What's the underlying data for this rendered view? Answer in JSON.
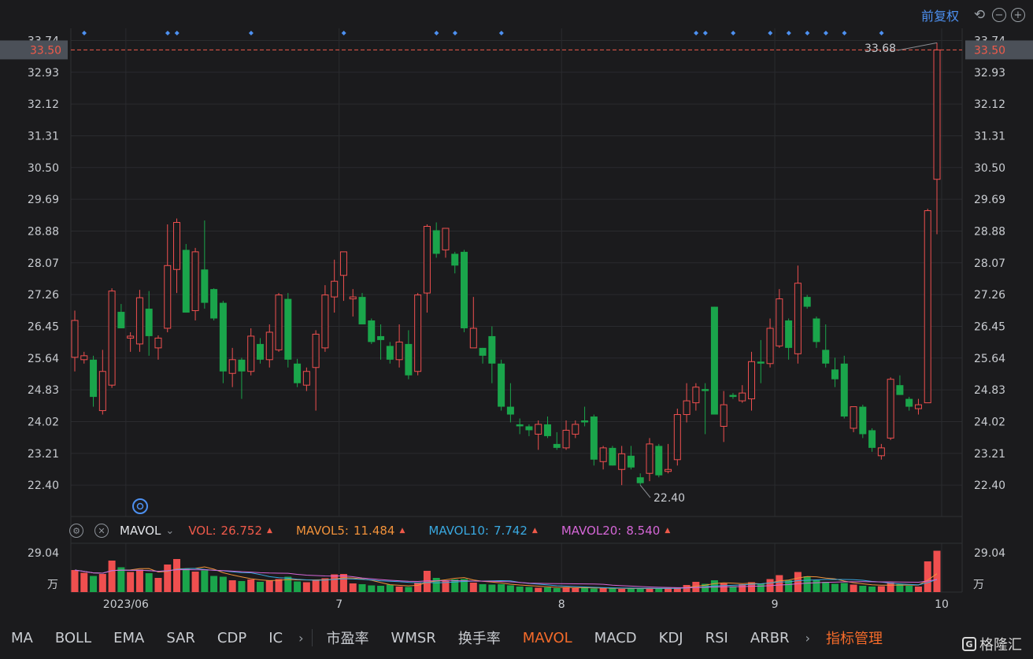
{
  "toolbar": {
    "adjust_label": "前复权",
    "undo_icon": "undo-icon",
    "zoom_out_icon": "minus-circle-icon",
    "zoom_in_icon": "plus-circle-icon"
  },
  "colors": {
    "up": "#ef4f4f",
    "down": "#1aa54b",
    "grid": "#2a2b2e",
    "price_tag": "#ef5a4a",
    "ma5": "#f0913a",
    "ma10": "#39a8e0",
    "ma20": "#d466d6"
  },
  "price_axis": {
    "ticks": [
      "33.74",
      "32.93",
      "32.12",
      "31.31",
      "30.50",
      "29.69",
      "28.88",
      "28.07",
      "27.26",
      "26.45",
      "25.64",
      "24.83",
      "24.02",
      "23.21",
      "22.40"
    ],
    "current_price": "33.50",
    "high_label": "33.68",
    "low_label": "22.40"
  },
  "volume_axis": {
    "top_label": "29.04",
    "unit_label": "万"
  },
  "date_axis": {
    "labels": [
      "2023/06",
      "7",
      "8",
      "9",
      "10"
    ]
  },
  "indicator": {
    "settings_icon": "gear-icon",
    "close_icon": "close-icon",
    "name": "MAVOL",
    "vol_label": "VOL:",
    "vol_value": "26.752",
    "mavol5_label": "MAVOL5:",
    "mavol5_value": "11.484",
    "mavol10_label": "MAVOL10:",
    "mavol10_value": "7.742",
    "mavol20_label": "MAVOL20:",
    "mavol20_value": "8.540"
  },
  "bottom_tabs": {
    "left": [
      "MA",
      "BOLL",
      "EMA",
      "SAR",
      "CDP",
      "IC"
    ],
    "right": [
      "市盈率",
      "WMSR",
      "换手率",
      "MAVOL",
      "MACD",
      "KDJ",
      "RSI",
      "ARBR"
    ],
    "active": "MAVOL",
    "manage": "指标管理",
    "logo_text": "格隆汇"
  },
  "chart_data": {
    "type": "candlestick",
    "ylim": [
      21.6,
      34.05
    ],
    "candles": [
      {
        "o": 25.66,
        "h": 26.85,
        "l": 25.3,
        "c": 26.6
      },
      {
        "o": 25.6,
        "h": 25.8,
        "l": 25.5,
        "c": 25.7
      },
      {
        "o": 25.6,
        "h": 25.7,
        "l": 24.4,
        "c": 24.65
      },
      {
        "o": 24.3,
        "h": 25.85,
        "l": 24.2,
        "c": 25.3
      },
      {
        "o": 24.95,
        "h": 27.42,
        "l": 24.88,
        "c": 27.35
      },
      {
        "o": 26.82,
        "h": 27.02,
        "l": 26.4,
        "c": 26.4
      },
      {
        "o": 26.15,
        "h": 26.3,
        "l": 25.8,
        "c": 26.2
      },
      {
        "o": 26.0,
        "h": 27.38,
        "l": 25.8,
        "c": 27.18
      },
      {
        "o": 26.9,
        "h": 27.35,
        "l": 25.7,
        "c": 26.2
      },
      {
        "o": 25.9,
        "h": 26.22,
        "l": 25.6,
        "c": 26.15
      },
      {
        "o": 26.4,
        "h": 29.05,
        "l": 26.3,
        "c": 28.0
      },
      {
        "o": 27.9,
        "h": 29.2,
        "l": 27.3,
        "c": 29.1
      },
      {
        "o": 28.4,
        "h": 28.55,
        "l": 26.8,
        "c": 26.8
      },
      {
        "o": 26.85,
        "h": 28.45,
        "l": 26.6,
        "c": 28.35
      },
      {
        "o": 27.9,
        "h": 29.15,
        "l": 26.9,
        "c": 27.05
      },
      {
        "o": 27.4,
        "h": 27.42,
        "l": 26.6,
        "c": 26.65
      },
      {
        "o": 27.05,
        "h": 27.1,
        "l": 25.0,
        "c": 25.3
      },
      {
        "o": 25.25,
        "h": 25.9,
        "l": 24.9,
        "c": 25.6
      },
      {
        "o": 25.6,
        "h": 25.65,
        "l": 24.6,
        "c": 25.3
      },
      {
        "o": 25.3,
        "h": 26.4,
        "l": 25.2,
        "c": 26.2
      },
      {
        "o": 26.0,
        "h": 26.15,
        "l": 25.5,
        "c": 25.6
      },
      {
        "o": 25.6,
        "h": 26.5,
        "l": 25.4,
        "c": 26.3
      },
      {
        "o": 25.85,
        "h": 27.3,
        "l": 25.8,
        "c": 27.25
      },
      {
        "o": 27.15,
        "h": 27.3,
        "l": 25.4,
        "c": 25.6
      },
      {
        "o": 25.5,
        "h": 25.62,
        "l": 24.9,
        "c": 25.0
      },
      {
        "o": 24.95,
        "h": 25.4,
        "l": 24.8,
        "c": 25.3
      },
      {
        "o": 25.4,
        "h": 26.35,
        "l": 24.3,
        "c": 26.25
      },
      {
        "o": 25.9,
        "h": 27.5,
        "l": 25.8,
        "c": 27.25
      },
      {
        "o": 27.2,
        "h": 28.15,
        "l": 26.8,
        "c": 27.6
      },
      {
        "o": 27.75,
        "h": 28.35,
        "l": 27.1,
        "c": 28.35
      },
      {
        "o": 27.15,
        "h": 27.4,
        "l": 26.7,
        "c": 27.2
      },
      {
        "o": 27.2,
        "h": 27.3,
        "l": 26.5,
        "c": 26.5
      },
      {
        "o": 26.6,
        "h": 26.65,
        "l": 26.0,
        "c": 26.05
      },
      {
        "o": 26.2,
        "h": 26.5,
        "l": 25.6,
        "c": 26.1
      },
      {
        "o": 25.95,
        "h": 26.05,
        "l": 25.5,
        "c": 25.6
      },
      {
        "o": 25.6,
        "h": 26.5,
        "l": 25.4,
        "c": 26.05
      },
      {
        "o": 26.0,
        "h": 26.35,
        "l": 25.1,
        "c": 25.2
      },
      {
        "o": 25.3,
        "h": 27.3,
        "l": 25.2,
        "c": 27.25
      },
      {
        "o": 27.3,
        "h": 29.05,
        "l": 26.8,
        "c": 29.0
      },
      {
        "o": 28.9,
        "h": 29.1,
        "l": 28.2,
        "c": 28.3
      },
      {
        "o": 28.4,
        "h": 28.95,
        "l": 28.2,
        "c": 28.95
      },
      {
        "o": 28.3,
        "h": 28.35,
        "l": 27.8,
        "c": 28.0
      },
      {
        "o": 28.35,
        "h": 28.4,
        "l": 26.3,
        "c": 26.4
      },
      {
        "o": 25.9,
        "h": 27.2,
        "l": 25.9,
        "c": 26.4
      },
      {
        "o": 25.9,
        "h": 25.9,
        "l": 25.5,
        "c": 25.7
      },
      {
        "o": 26.2,
        "h": 26.45,
        "l": 25.0,
        "c": 25.5
      },
      {
        "o": 25.5,
        "h": 25.6,
        "l": 24.3,
        "c": 24.4
      },
      {
        "o": 24.4,
        "h": 25.0,
        "l": 24.0,
        "c": 24.2
      },
      {
        "o": 23.95,
        "h": 24.1,
        "l": 23.7,
        "c": 23.9
      },
      {
        "o": 23.9,
        "h": 23.95,
        "l": 23.65,
        "c": 23.8
      },
      {
        "o": 23.7,
        "h": 24.05,
        "l": 23.3,
        "c": 23.95
      },
      {
        "o": 23.95,
        "h": 24.15,
        "l": 23.6,
        "c": 23.65
      },
      {
        "o": 23.45,
        "h": 23.75,
        "l": 23.3,
        "c": 23.35
      },
      {
        "o": 23.35,
        "h": 24.05,
        "l": 23.3,
        "c": 23.8
      },
      {
        "o": 23.7,
        "h": 24.05,
        "l": 23.6,
        "c": 23.95
      },
      {
        "o": 24.05,
        "h": 24.4,
        "l": 23.9,
        "c": 24.0
      },
      {
        "o": 24.15,
        "h": 24.2,
        "l": 22.9,
        "c": 23.05
      },
      {
        "o": 23.0,
        "h": 23.4,
        "l": 22.8,
        "c": 23.35
      },
      {
        "o": 23.35,
        "h": 23.4,
        "l": 22.9,
        "c": 22.9
      },
      {
        "o": 22.8,
        "h": 23.4,
        "l": 22.4,
        "c": 23.2
      },
      {
        "o": 23.15,
        "h": 23.4,
        "l": 22.8,
        "c": 22.85
      },
      {
        "o": 22.6,
        "h": 22.7,
        "l": 22.4,
        "c": 22.45
      },
      {
        "o": 22.7,
        "h": 23.6,
        "l": 22.5,
        "c": 23.45
      },
      {
        "o": 23.4,
        "h": 23.45,
        "l": 22.6,
        "c": 22.65
      },
      {
        "o": 22.75,
        "h": 23.45,
        "l": 22.7,
        "c": 22.8
      },
      {
        "o": 23.05,
        "h": 24.35,
        "l": 22.9,
        "c": 24.2
      },
      {
        "o": 24.2,
        "h": 25.0,
        "l": 24.0,
        "c": 24.55
      },
      {
        "o": 24.5,
        "h": 25.0,
        "l": 24.3,
        "c": 24.9
      },
      {
        "o": 24.85,
        "h": 25.0,
        "l": 23.7,
        "c": 24.8
      },
      {
        "o": 26.95,
        "h": 26.95,
        "l": 24.2,
        "c": 24.2
      },
      {
        "o": 23.9,
        "h": 24.8,
        "l": 23.5,
        "c": 24.45
      },
      {
        "o": 24.7,
        "h": 24.75,
        "l": 24.6,
        "c": 24.65
      },
      {
        "o": 24.55,
        "h": 24.95,
        "l": 24.5,
        "c": 24.75
      },
      {
        "o": 24.6,
        "h": 25.8,
        "l": 24.3,
        "c": 25.55
      },
      {
        "o": 25.55,
        "h": 26.1,
        "l": 25.0,
        "c": 25.5
      },
      {
        "o": 25.5,
        "h": 26.65,
        "l": 25.4,
        "c": 26.4
      },
      {
        "o": 25.95,
        "h": 27.4,
        "l": 25.9,
        "c": 27.15
      },
      {
        "o": 26.6,
        "h": 26.65,
        "l": 25.6,
        "c": 25.9
      },
      {
        "o": 25.75,
        "h": 28.0,
        "l": 25.5,
        "c": 27.55
      },
      {
        "o": 27.2,
        "h": 27.25,
        "l": 26.9,
        "c": 26.95
      },
      {
        "o": 26.65,
        "h": 26.7,
        "l": 25.9,
        "c": 26.05
      },
      {
        "o": 25.85,
        "h": 26.5,
        "l": 25.4,
        "c": 25.5
      },
      {
        "o": 25.35,
        "h": 25.65,
        "l": 24.9,
        "c": 25.1
      },
      {
        "o": 25.5,
        "h": 25.7,
        "l": 24.1,
        "c": 24.15
      },
      {
        "o": 23.85,
        "h": 24.4,
        "l": 23.75,
        "c": 24.4
      },
      {
        "o": 24.4,
        "h": 24.45,
        "l": 23.6,
        "c": 23.7
      },
      {
        "o": 23.8,
        "h": 23.85,
        "l": 23.25,
        "c": 23.35
      },
      {
        "o": 23.15,
        "h": 23.45,
        "l": 23.05,
        "c": 23.35
      },
      {
        "o": 23.6,
        "h": 25.15,
        "l": 23.55,
        "c": 25.1
      },
      {
        "o": 24.95,
        "h": 25.2,
        "l": 24.7,
        "c": 24.7
      },
      {
        "o": 24.6,
        "h": 24.65,
        "l": 24.3,
        "c": 24.4
      },
      {
        "o": 24.35,
        "h": 24.6,
        "l": 24.2,
        "c": 24.45
      },
      {
        "o": 24.5,
        "h": 29.45,
        "l": 24.5,
        "c": 29.4
      },
      {
        "o": 30.2,
        "h": 33.68,
        "l": 28.8,
        "c": 33.5
      }
    ],
    "volumes": [
      5.6,
      4.9,
      4.1,
      4.6,
      8.0,
      6.3,
      5.1,
      5.7,
      4.8,
      3.6,
      7.0,
      8.4,
      5.9,
      5.2,
      5.5,
      4.1,
      3.9,
      3.0,
      2.8,
      3.2,
      2.6,
      3.0,
      3.3,
      3.9,
      2.7,
      2.5,
      3.1,
      3.5,
      4.5,
      4.6,
      2.2,
      2.0,
      1.7,
      1.6,
      1.9,
      1.4,
      1.3,
      2.4,
      5.4,
      3.6,
      2.9,
      3.2,
      3.3,
      2.4,
      2.0,
      1.9,
      2.0,
      1.7,
      1.4,
      1.3,
      1.1,
      1.2,
      1.0,
      1.3,
      1.0,
      1.1,
      0.9,
      1.0,
      0.9,
      0.8,
      1.0,
      0.8,
      1.0,
      0.9,
      1.0,
      1.2,
      1.8,
      2.6,
      2.1,
      3.0,
      2.2,
      1.5,
      2.0,
      2.5,
      2.2,
      3.3,
      4.3,
      3.0,
      5.1,
      4.0,
      3.0,
      2.6,
      2.1,
      2.3,
      1.9,
      1.6,
      1.4,
      1.5,
      2.4,
      2.0,
      1.6,
      1.4,
      7.8,
      10.5
    ]
  }
}
